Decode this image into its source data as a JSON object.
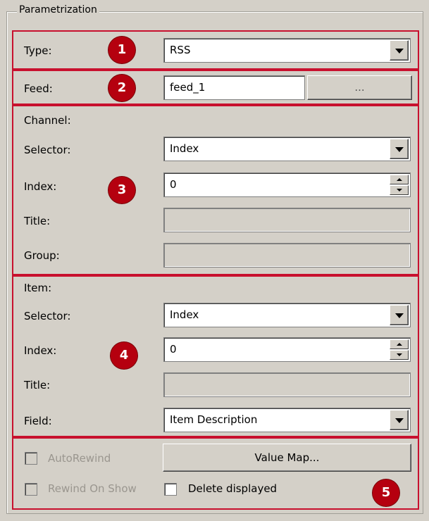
{
  "group": {
    "title": "Parametrization"
  },
  "type_row": {
    "label": "Type:",
    "value": "RSS",
    "badge": "1"
  },
  "feed_row": {
    "label": "Feed:",
    "value": "feed_1",
    "browse_label": "...",
    "badge": "2"
  },
  "channel": {
    "header": "Channel:",
    "selector_label": "Selector:",
    "selector_value": "Index",
    "index_label": "Index:",
    "index_value": "0",
    "title_label": "Title:",
    "group_label": "Group:",
    "badge": "3"
  },
  "item": {
    "header": "Item:",
    "selector_label": "Selector:",
    "selector_value": "Index",
    "index_label": "Index:",
    "index_value": "0",
    "title_label": "Title:",
    "field_label": "Field:",
    "field_value": "Item Description",
    "badge": "4"
  },
  "options": {
    "autorewind_label": "AutoRewind",
    "rewind_on_show_label": "Rewind On Show",
    "delete_displayed_label": "Delete displayed",
    "value_map_label": "Value Map...",
    "badge": "5"
  },
  "colors": {
    "highlight": "#c8102e",
    "badge": "#b5000f",
    "background": "#d4d0c8"
  }
}
